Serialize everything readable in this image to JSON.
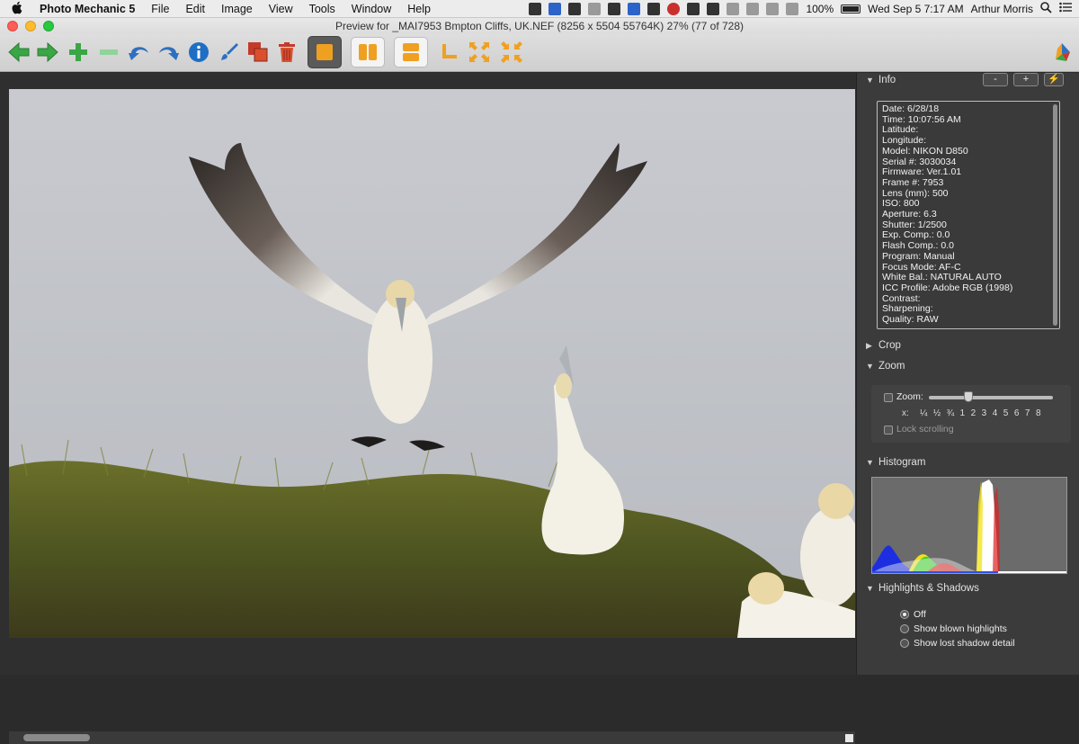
{
  "menubar": {
    "app_name": "Photo Mechanic 5",
    "items": [
      "File",
      "Edit",
      "Image",
      "View",
      "Tools",
      "Window",
      "Help"
    ],
    "battery": "100%",
    "clock": "Wed Sep 5  7:17 AM",
    "user": "Arthur Morris"
  },
  "window": {
    "title": "Preview for _MAI7953 Bmpton Cliffs, UK.NEF (8256 x 5504 55764K) 27% (77 of 728)"
  },
  "toolbar": {
    "buttons": [
      "previous-arrow-icon",
      "next-arrow-icon",
      "plus-icon",
      "minus-icon",
      "undo-icon",
      "redo-icon",
      "info-icon",
      "edit-brush-icon",
      "copy-icon",
      "trash-icon",
      "single-view-icon",
      "side-by-side-icon",
      "stacked-icon",
      "crop-corner-icon",
      "zoom-fit-icon",
      "zoom-fill-icon",
      "app-logo-icon"
    ]
  },
  "panel": {
    "info": {
      "title": "Info",
      "btn_minus": "-",
      "btn_plus": "+",
      "rows": [
        "Date: 6/28/18",
        "Time: 10:07:56 AM",
        "Latitude:",
        "Longitude:",
        "Model: NIKON D850",
        "Serial #: 3030034",
        "Firmware: Ver.1.01",
        "Frame #: 7953",
        "Lens (mm): 500",
        "ISO: 800",
        "Aperture: 6.3",
        "Shutter: 1/2500",
        "Exp. Comp.: 0.0",
        "Flash Comp.: 0.0",
        "Program: Manual",
        "Focus Mode: AF-C",
        "White Bal.: NATURAL AUTO",
        "ICC Profile: Adobe RGB (1998)",
        "Contrast:",
        "Sharpening:",
        "Quality: RAW"
      ]
    },
    "crop": {
      "title": "Crop"
    },
    "zoom": {
      "title": "Zoom",
      "zoom_label": "Zoom:",
      "x_label": "x:",
      "ticks": [
        "¼",
        "½",
        "¾",
        "1",
        "2",
        "3",
        "4",
        "5",
        "6",
        "7",
        "8"
      ],
      "lock_label": "Lock scrolling"
    },
    "histogram": {
      "title": "Histogram"
    },
    "highlights": {
      "title": "Highlights & Shadows",
      "options": [
        "Off",
        "Show blown highlights",
        "Show lost shadow detail"
      ],
      "selected": "Off"
    }
  }
}
